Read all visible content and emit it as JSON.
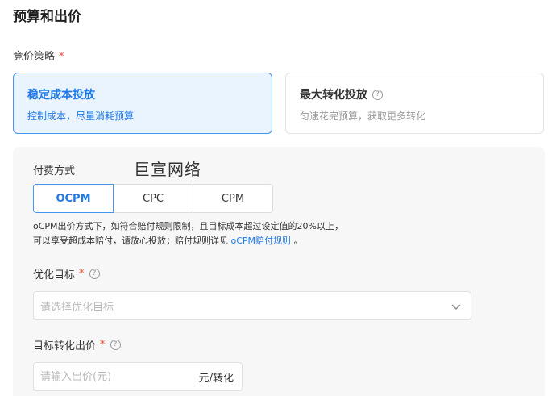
{
  "section": {
    "title": "预算和出价"
  },
  "bid_strategy": {
    "label": "竞价策略",
    "required_mark": "*",
    "cards": [
      {
        "title": "稳定成本投放",
        "desc": "控制成本，尽量消耗预算",
        "selected": true
      },
      {
        "title": "最大转化投放",
        "desc": "匀速花完预算，获取更多转化",
        "selected": false
      }
    ]
  },
  "billing": {
    "label": "付费方式",
    "watermark": "巨宣网络",
    "options": [
      "OCPM",
      "CPC",
      "CPM"
    ],
    "selected": "OCPM",
    "note_line1": "oCPM出价方式下，如符合赔付规则限制，且目标成本超过设定值的20%以上，",
    "note_line2_prefix": "可以享受超成本赔付，请放心投放；赔付规则详见 ",
    "note_link": "oCPM赔付规则",
    "note_line2_suffix": " 。"
  },
  "optimize_goal": {
    "label": "优化目标",
    "required_mark": "*",
    "placeholder": "请选择优化目标"
  },
  "target_bid": {
    "label": "目标转化出价",
    "required_mark": "*",
    "placeholder": "请输入出价(元)",
    "suffix": "元/转化"
  },
  "icons": {
    "help": "?",
    "help_icon": "question-circle-icon",
    "dropdown_icon": "chevron-down-icon"
  },
  "colors": {
    "accent": "#1f7ae8",
    "required": "#f5462e",
    "panel_bg": "#f7f7f7"
  }
}
